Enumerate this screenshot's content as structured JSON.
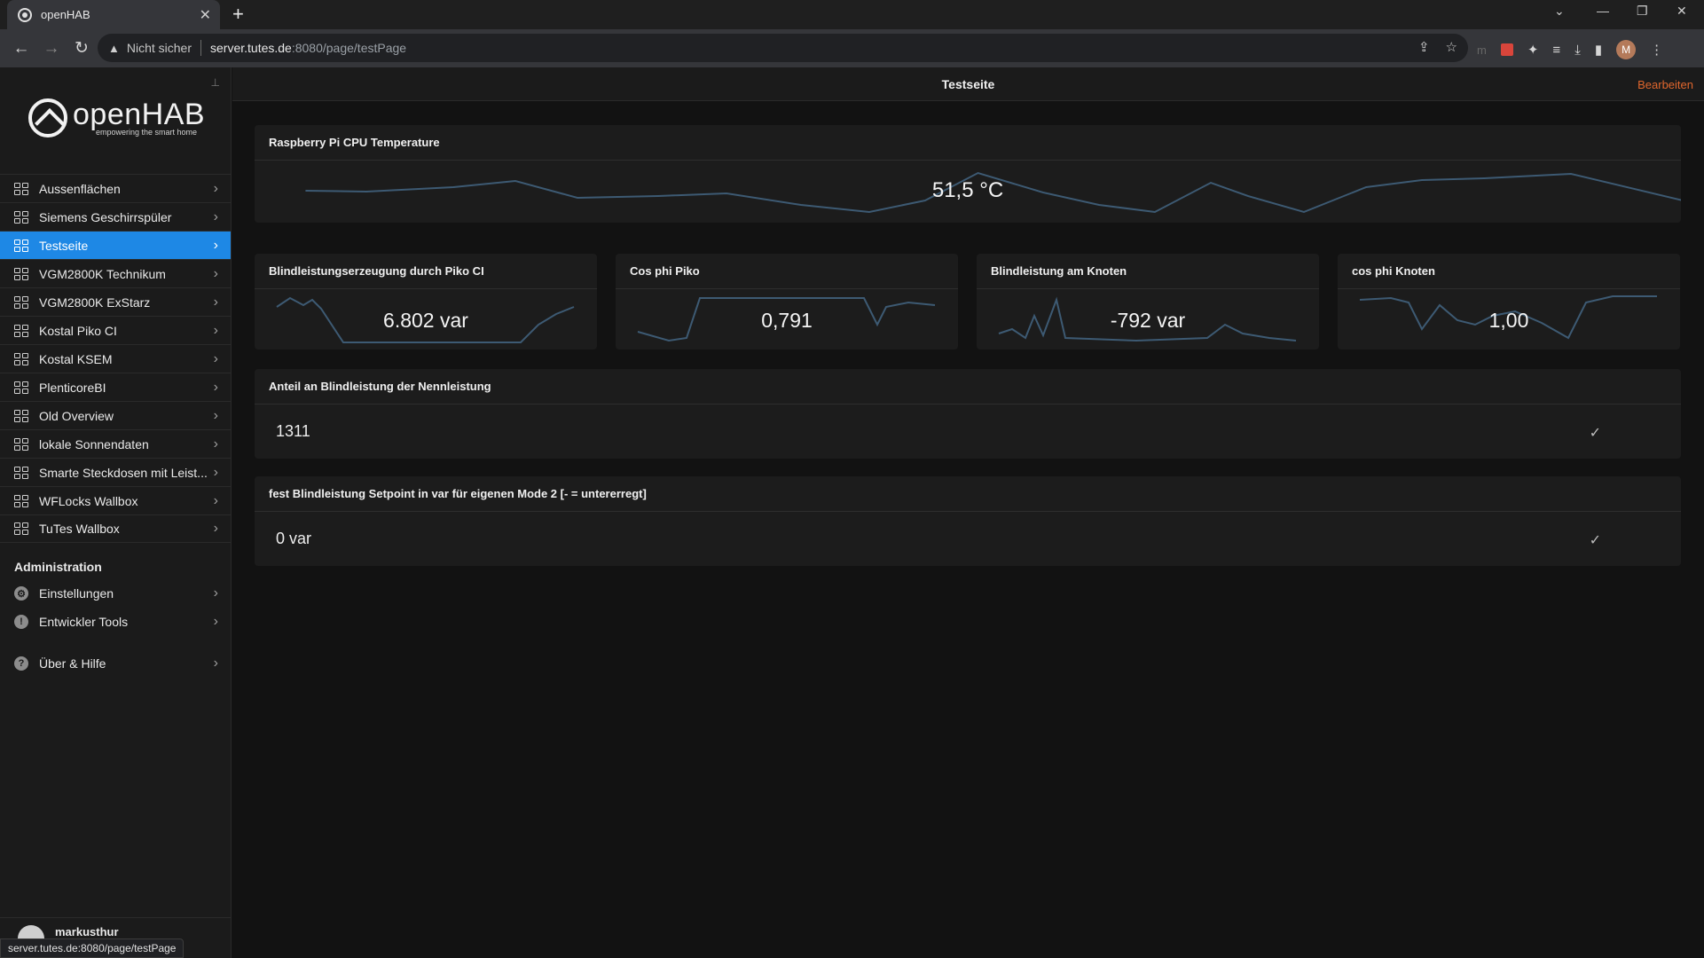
{
  "browser": {
    "tab_title": "openHAB",
    "insecure_label": "Nicht sicher",
    "url_host": "server.tutes.de",
    "url_rest": ":8080/page/testPage",
    "avatar_letter": "M",
    "status_url": "server.tutes.de:8080/page/testPage"
  },
  "sidebar": {
    "logo_name": "openHAB",
    "logo_tagline": "empowering the smart home",
    "items": [
      {
        "label": "Aussenflächen"
      },
      {
        "label": "Siemens Geschirrspüler"
      },
      {
        "label": "Testseite"
      },
      {
        "label": "VGM2800K Technikum"
      },
      {
        "label": "VGM2800K ExStarz"
      },
      {
        "label": "Kostal Piko CI"
      },
      {
        "label": "Kostal KSEM"
      },
      {
        "label": "PlenticoreBI"
      },
      {
        "label": "Old Overview"
      },
      {
        "label": "lokale Sonnendaten"
      },
      {
        "label": "Smarte Steckdosen mit Leist..."
      },
      {
        "label": "WFLocks Wallbox"
      },
      {
        "label": "TuTes Wallbox"
      }
    ],
    "active_index": 2,
    "admin_title": "Administration",
    "admin_items": [
      {
        "label": "Einstellungen"
      },
      {
        "label": "Entwickler Tools"
      }
    ],
    "help_label": "Über & Hilfe",
    "username": "markusthur"
  },
  "page": {
    "title": "Testseite",
    "edit_label": "Bearbeiten",
    "temp_card": {
      "title": "Raspberry Pi CPU Temperature",
      "value": "51,5 °C"
    },
    "small_cards": [
      {
        "title": "Blindleistungserzeugung durch Piko CI",
        "value": "6.802 var"
      },
      {
        "title": "Cos phi Piko",
        "value": "0,791"
      },
      {
        "title": "Blindleistung am Knoten",
        "value": "-792 var"
      },
      {
        "title": "cos phi Knoten",
        "value": "1,00"
      }
    ],
    "list_cards": [
      {
        "title": "Anteil an Blindleistung der Nennleistung",
        "value": "1311"
      },
      {
        "title": "fest Blindleistung Setpoint in var für eigenen Mode 2 [- = untererregt]",
        "value": "0 var"
      }
    ]
  },
  "colors": {
    "accent": "#1e88e5",
    "edit_link": "#e0662d",
    "sparkline": "#3d5a73"
  }
}
